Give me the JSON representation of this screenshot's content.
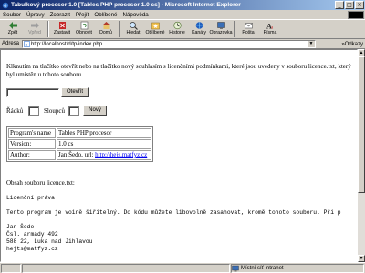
{
  "window": {
    "title": "Tabulkový procesor 1.0 [Tables PHP procesor 1.0 cs] - Microsoft Internet Explorer"
  },
  "menu": {
    "items": [
      "Soubor",
      "Úpravy",
      "Zobrazit",
      "Přejít",
      "Oblíbené",
      "Nápověda"
    ]
  },
  "toolbar": {
    "buttons": [
      {
        "label": "Zpět",
        "icon": "back-arrow-icon"
      },
      {
        "label": "Vpřed",
        "icon": "forward-arrow-icon"
      },
      {
        "label": "Zastavit",
        "icon": "stop-icon"
      },
      {
        "label": "Obnovit",
        "icon": "refresh-icon"
      },
      {
        "label": "Domů",
        "icon": "home-icon"
      },
      {
        "label": "Hledat",
        "icon": "search-icon"
      },
      {
        "label": "Oblíbené",
        "icon": "favorites-icon"
      },
      {
        "label": "Historie",
        "icon": "history-icon"
      },
      {
        "label": "Kanály",
        "icon": "channels-icon"
      },
      {
        "label": "Obrazovka",
        "icon": "fullscreen-icon"
      },
      {
        "label": "Pošta",
        "icon": "mail-icon"
      },
      {
        "label": "Písma",
        "icon": "fonts-icon"
      }
    ]
  },
  "address": {
    "label": "Adresa",
    "url": "http://localhost/d/tp/index.php",
    "links_label": "Odkazy"
  },
  "page": {
    "intro": "Klknutím na tlačítko otevřít nebo na tlačítko nový souhlasím s licenčními podmínkami, které jsou uvedeny v souboru licence.txt, který byl umístěn u tohoto souboru.",
    "open_button": "Otevřít",
    "rows_label": "Řádků",
    "cols_label": "Sloupců",
    "new_button": "Nový",
    "info": {
      "program_key": "Program's name",
      "program_val": "Tables PHP procesor",
      "version_key": "Version:",
      "version_val": "1.0 cs",
      "author_key": "Author:",
      "author_prefix": "Jan Šedo, url: ",
      "author_link": "http://hejs.matfyz.cz"
    },
    "file_caption": "Obsah souboru licence.txt:",
    "license_title": "Licenční práva",
    "license_line": "Tento program je voině šiřitelný. Do kódu můžete libovolně zasahovat, kromě tohoto souboru. Při p",
    "contact": "Jan Šedo\nČsl. armády 492\n588 22, Luka nad Jihlavou\nhejts@matfyz.cz"
  },
  "status": {
    "zone": "Místní síť intranet"
  }
}
